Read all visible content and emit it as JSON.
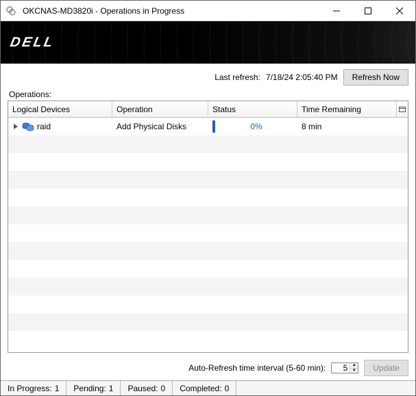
{
  "window": {
    "title": "OKCNAS-MD3820i - Operations in Progress"
  },
  "banner": {
    "logo": "DELL"
  },
  "refresh": {
    "last_refresh_label": "Last refresh:",
    "last_refresh_time": "7/18/24 2:05:40 PM",
    "refresh_now_label": "Refresh Now"
  },
  "operations_label": "Operations:",
  "columns": {
    "devices": "Logical Devices",
    "operation": "Operation",
    "status": "Status",
    "time": "Time Remaining"
  },
  "rows": [
    {
      "device": "raid",
      "operation": "Add Physical Disks",
      "status_percent": "0%",
      "time_remaining": "8 min"
    }
  ],
  "autorefresh": {
    "label": "Auto-Refresh time interval (5-60 min):",
    "value": "5",
    "update_label": "Update"
  },
  "statusbar": {
    "in_progress_label": "In Progress:",
    "in_progress_val": "1",
    "pending_label": "Pending:",
    "pending_val": "1",
    "paused_label": "Paused:",
    "paused_val": "0",
    "completed_label": "Completed:",
    "completed_val": "0"
  }
}
